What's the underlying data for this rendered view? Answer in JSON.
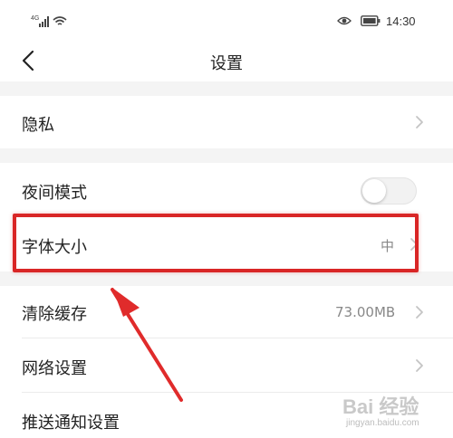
{
  "status_bar": {
    "signal_label": "4G",
    "time": "14:30",
    "icons": [
      "signal-icon",
      "wifi-icon",
      "eye-icon",
      "battery-icon"
    ]
  },
  "header": {
    "title": "设置",
    "back_icon": "back-chevron-icon"
  },
  "settings": {
    "privacy": {
      "label": "隐私"
    },
    "night_mode": {
      "label": "夜间模式",
      "enabled": false
    },
    "font_size": {
      "label": "字体大小",
      "value": "中"
    },
    "clear_cache": {
      "label": "清除缓存",
      "value": "73.00MB"
    },
    "network": {
      "label": "网络设置"
    },
    "push": {
      "label": "推送通知设置"
    }
  },
  "annotation": {
    "highlight_color": "#d92626",
    "arrow_color": "#e02b2b"
  },
  "watermark": {
    "logo": "Bai 经验",
    "url": "jingyan.baidu.com"
  }
}
